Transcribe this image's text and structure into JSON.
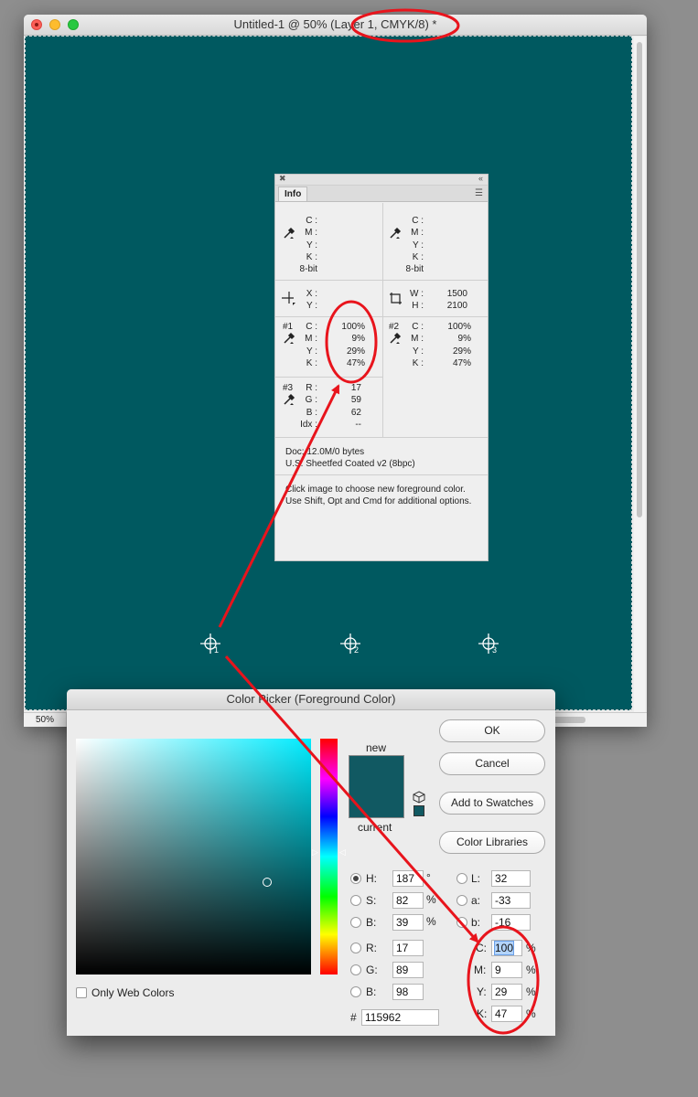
{
  "window": {
    "title": "Untitled-1 @ 50% (Layer 1, CMYK/8) *",
    "zoom": "50%",
    "canvas_color": "#005960"
  },
  "info_panel": {
    "tab": "Info",
    "top_left": {
      "labels": "C :\nM :\nY :\nK :",
      "bit": "8-bit"
    },
    "top_right": {
      "labels": "C :\nM :\nY :\nK :",
      "bit": "8-bit"
    },
    "xy": {
      "labels": "X :\nY :"
    },
    "wh": {
      "labels": "W :\nH :",
      "values": "1500\n2100"
    },
    "s1": {
      "tag": "#1",
      "labels": "C :\nM :\nY :\nK :",
      "values": "100%\n9%\n29%\n47%"
    },
    "s2": {
      "tag": "#2",
      "labels": "C :\nM :\nY :\nK :",
      "values": "100%\n9%\n29%\n47%"
    },
    "s3": {
      "tag": "#3",
      "labels": "R :\nG :\nB :\nIdx :",
      "values": "17\n59\n62\n--"
    },
    "doc": "Doc: 12.0M/0 bytes",
    "profile": "U.S. Sheetfed Coated v2 (8bpc)",
    "message": "Click image to choose new foreground color.  Use Shift, Opt and Cmd for additional options."
  },
  "samplers": [
    "1",
    "2",
    "3"
  ],
  "color_picker": {
    "title": "Color Picker (Foreground Color)",
    "new_label": "new",
    "current_label": "current",
    "swatch_color": "#115962",
    "buttons": {
      "ok": "OK",
      "cancel": "Cancel",
      "add_swatches": "Add to Swatches",
      "color_libraries": "Color Libraries"
    },
    "hsb": {
      "h_label": "H:",
      "h": "187",
      "h_unit": "°",
      "s_label": "S:",
      "s": "82",
      "s_unit": "%",
      "b_label": "B:",
      "b": "39",
      "b_unit": "%"
    },
    "rgb": {
      "r_label": "R:",
      "r": "17",
      "g_label": "G:",
      "g": "89",
      "b_label": "B:",
      "b": "98"
    },
    "lab": {
      "l_label": "L:",
      "l": "32",
      "a_label": "a:",
      "a": "-33",
      "b_label": "b:",
      "b": "-16"
    },
    "cmyk": {
      "c_label": "C:",
      "c": "100",
      "m_label": "M:",
      "m": "9",
      "y_label": "Y:",
      "y": "29",
      "k_label": "K:",
      "k": "47",
      "unit": "%"
    },
    "hex_label": "#",
    "hex": "115962",
    "only_web_colors": "Only Web Colors"
  },
  "annotation_color": "#e8141c"
}
